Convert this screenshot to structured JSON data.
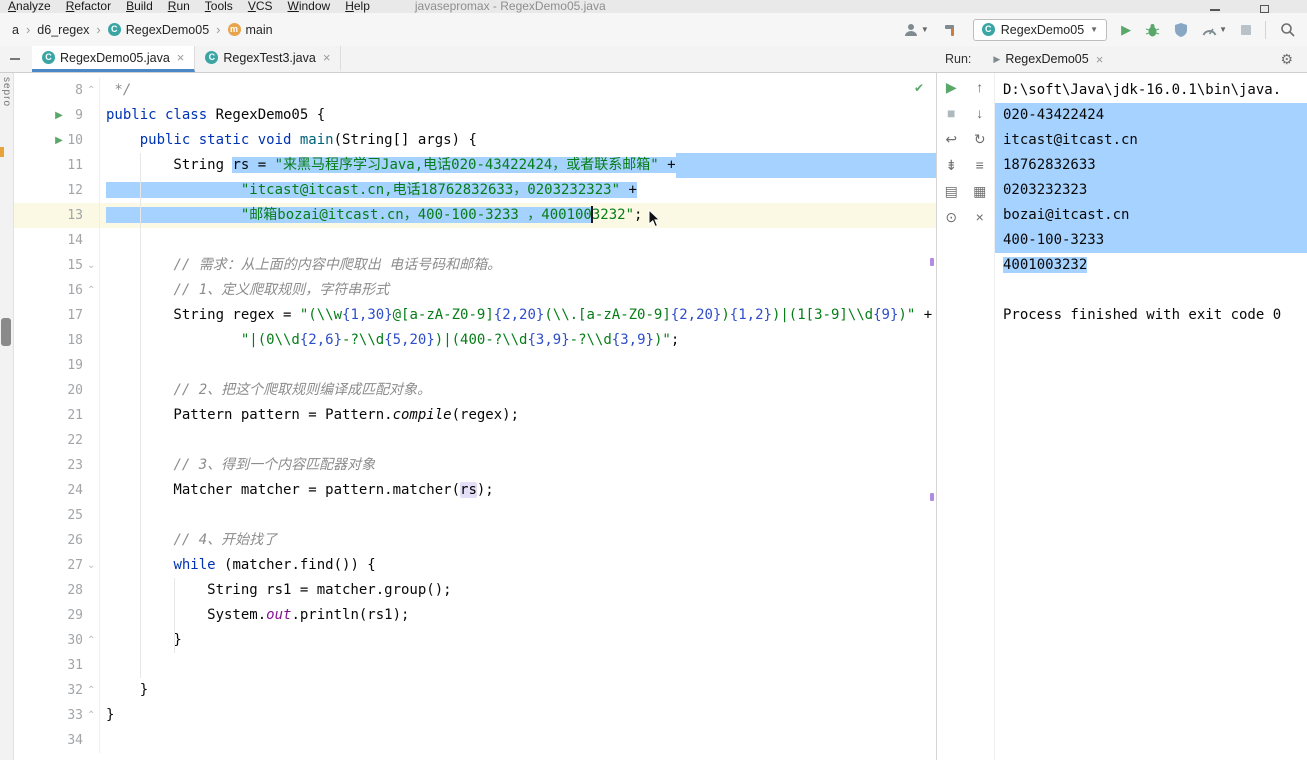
{
  "window": {
    "menus": [
      "Analyze",
      "Refactor",
      "Build",
      "Run",
      "Tools",
      "VCS",
      "Window",
      "Help"
    ],
    "title": "javasepromax - RegexDemo05.java"
  },
  "icons": {
    "gear": "⚙",
    "close": "×",
    "check": "✔",
    "chevron_down": "▼",
    "run": "▶",
    "breadcrumb_sep": "›",
    "fold_open": "⌄",
    "fold_close": "⌃",
    "class_letter": "C",
    "method_letter": "m"
  },
  "toolbar": {
    "breadcrumbs": [
      {
        "label": "a",
        "icon": null
      },
      {
        "label": "d6_regex",
        "icon": null
      },
      {
        "label": "RegexDemo05",
        "icon": "class"
      },
      {
        "label": "main",
        "icon": "method"
      }
    ],
    "run_config": {
      "label": "RegexDemo05"
    }
  },
  "tabbar": {
    "editor_tabs": [
      {
        "label": "RegexDemo05.java",
        "active": true
      },
      {
        "label": "RegexTest3.java",
        "active": false
      }
    ],
    "run_label": "Run:",
    "run_tab": {
      "label": "RegexDemo05"
    }
  },
  "left_strip": {
    "label": "sepro"
  },
  "colors": {
    "selection": "#A6D2FF",
    "accent_green": "#59A869",
    "keyword": "#0033B3",
    "string": "#067D17"
  },
  "editor": {
    "lines": [
      {
        "n": 8,
        "g": "chev-u",
        "seg": [
          [
            " */",
            "c"
          ]
        ]
      },
      {
        "n": 9,
        "g": "run",
        "seg": [
          [
            "public class ",
            "k"
          ],
          [
            "RegexDemo05 {",
            "p"
          ]
        ]
      },
      {
        "n": 10,
        "g": "run",
        "seg": [
          [
            "    ",
            "p"
          ],
          [
            "public static void ",
            "k"
          ],
          [
            "main",
            "m"
          ],
          [
            "(String[] args) {",
            "p"
          ]
        ]
      },
      {
        "n": 11,
        "edge": true,
        "seg": [
          [
            "        String ",
            "p"
          ],
          [
            "rs = ",
            "p",
            1
          ],
          [
            "\"来黑马程序学习Java,电话020-43422424，或者联系邮箱\"",
            "s",
            1
          ],
          [
            " +",
            "p",
            1
          ]
        ]
      },
      {
        "n": 12,
        "seg": [
          [
            "                ",
            "p",
            1
          ],
          [
            "\"itcast@itcast.cn,电话18762832633，0203232323\"",
            "s",
            1
          ],
          [
            " +",
            "p",
            1
          ]
        ]
      },
      {
        "n": 13,
        "cur": true,
        "seg": [
          [
            "                ",
            "p",
            1
          ],
          [
            "\"邮箱bozai@itcast.cn，400-100-3233 ，400100",
            "s",
            1
          ],
          [
            "",
            "caret"
          ],
          [
            "3232\"",
            "s"
          ],
          [
            ";",
            "p"
          ]
        ]
      },
      {
        "n": 14,
        "seg": []
      },
      {
        "n": 15,
        "g": "chev-d",
        "seg": [
          [
            "        ",
            "p"
          ],
          [
            "// 需求：从上面的内容中爬取出 电话号码和邮箱。",
            "c"
          ]
        ]
      },
      {
        "n": 16,
        "g": "chev-u",
        "seg": [
          [
            "        ",
            "p"
          ],
          [
            "// 1、定义爬取规则，字符串形式",
            "c"
          ]
        ]
      },
      {
        "n": 17,
        "seg": [
          [
            "        String regex = ",
            "p"
          ],
          [
            "\"(\\\\w",
            "s"
          ],
          [
            "{1,30}",
            "q"
          ],
          [
            "@[a-zA-Z0-9]",
            "s"
          ],
          [
            "{2,20}",
            "q"
          ],
          [
            "(\\\\.[a-zA-Z0-9]",
            "s"
          ],
          [
            "{2,20}",
            "q"
          ],
          [
            ")",
            "s"
          ],
          [
            "{1,2}",
            "q"
          ],
          [
            ")|(1[3-9]\\\\d",
            "s"
          ],
          [
            "{9}",
            "q"
          ],
          [
            ")\"",
            "s"
          ],
          [
            " +",
            "p"
          ]
        ]
      },
      {
        "n": 18,
        "seg": [
          [
            "                ",
            "p"
          ],
          [
            "\"|(0\\\\d",
            "s"
          ],
          [
            "{2,6}",
            "q"
          ],
          [
            "-?\\\\d",
            "s"
          ],
          [
            "{5,20}",
            "q"
          ],
          [
            ")|(400-?\\\\d",
            "s"
          ],
          [
            "{3,9}",
            "q"
          ],
          [
            "-?\\\\d",
            "s"
          ],
          [
            "{3,9}",
            "q"
          ],
          [
            ")\"",
            "s"
          ],
          [
            ";",
            "p"
          ]
        ]
      },
      {
        "n": 19,
        "seg": []
      },
      {
        "n": 20,
        "seg": [
          [
            "        ",
            "p"
          ],
          [
            "// 2、把这个爬取规则编译成匹配对象。",
            "c"
          ]
        ]
      },
      {
        "n": 21,
        "seg": [
          [
            "        Pattern pattern = Pattern.",
            "p"
          ],
          [
            "compile",
            "i"
          ],
          [
            "(regex);",
            "p"
          ]
        ]
      },
      {
        "n": 22,
        "seg": []
      },
      {
        "n": 23,
        "seg": [
          [
            "        ",
            "p"
          ],
          [
            "// 3、得到一个内容匹配器对象",
            "c"
          ]
        ]
      },
      {
        "n": 24,
        "seg": [
          [
            "        Matcher matcher = pattern.matcher(",
            "p"
          ],
          [
            "rs",
            "u"
          ],
          [
            ");",
            "p"
          ]
        ]
      },
      {
        "n": 25,
        "seg": []
      },
      {
        "n": 26,
        "seg": [
          [
            "        ",
            "p"
          ],
          [
            "// 4、开始找了",
            "c"
          ]
        ]
      },
      {
        "n": 27,
        "g": "chev-d",
        "seg": [
          [
            "        ",
            "p"
          ],
          [
            "while ",
            "k"
          ],
          [
            "(matcher.find()) {",
            "p"
          ]
        ]
      },
      {
        "n": 28,
        "seg": [
          [
            "            String rs1 = matcher.group();",
            "p"
          ]
        ]
      },
      {
        "n": 29,
        "seg": [
          [
            "            System.",
            "p"
          ],
          [
            "out",
            "f"
          ],
          [
            ".println(rs1);",
            "p"
          ]
        ]
      },
      {
        "n": 30,
        "g": "chev-u",
        "seg": [
          [
            "        }",
            "p"
          ]
        ]
      },
      {
        "n": 31,
        "seg": []
      },
      {
        "n": 32,
        "g": "chev-u",
        "seg": [
          [
            "    }",
            "p"
          ]
        ]
      },
      {
        "n": 33,
        "g": "chev-u",
        "seg": [
          [
            "}",
            "p"
          ]
        ]
      },
      {
        "n": 34,
        "seg": []
      }
    ]
  },
  "run_toolbar": {
    "col1": [
      {
        "name": "rerun-icon",
        "glyph": "▶",
        "color": "#59A869"
      },
      {
        "name": "stop-icon",
        "glyph": "■",
        "color": "#AEB9BF"
      },
      {
        "name": "soft-wrap-icon",
        "glyph": "↩"
      },
      {
        "name": "scroll-to-end-icon",
        "glyph": "⇟"
      },
      {
        "name": "print-icon",
        "glyph": "▤"
      },
      {
        "name": "pin-icon",
        "glyph": "⊙"
      }
    ],
    "col2": [
      {
        "name": "step-up-icon",
        "glyph": "↑"
      },
      {
        "name": "step-down-icon",
        "glyph": "↓"
      },
      {
        "name": "restore-layout-icon",
        "glyph": "↻"
      },
      {
        "name": "options-icon",
        "glyph": "≡"
      },
      {
        "name": "clear-icon",
        "glyph": "▦"
      },
      {
        "name": "delete-icon",
        "glyph": "×"
      }
    ]
  },
  "console": {
    "lines": [
      {
        "t": "D:\\soft\\Java\\jdk-16.0.1\\bin\\java.",
        "sel": "none"
      },
      {
        "t": "020-43422424",
        "sel": "full"
      },
      {
        "t": "itcast@itcast.cn",
        "sel": "full"
      },
      {
        "t": "18762832633",
        "sel": "full"
      },
      {
        "t": "0203232323",
        "sel": "full"
      },
      {
        "t": "bozai@itcast.cn",
        "sel": "full"
      },
      {
        "t": "400-100-3233",
        "sel": "full"
      },
      {
        "t": "4001003232",
        "sel": "text"
      },
      {
        "t": "",
        "sel": "none"
      },
      {
        "t": "Process finished with exit code 0",
        "sel": "none"
      }
    ]
  }
}
